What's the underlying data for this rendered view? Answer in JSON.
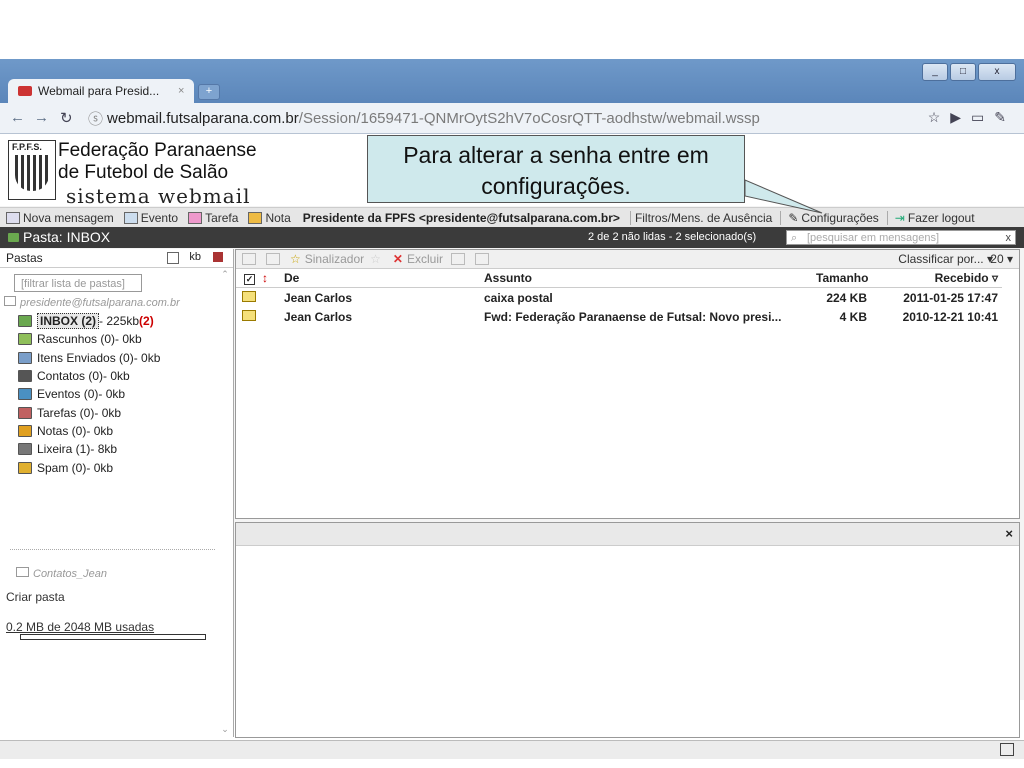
{
  "browser": {
    "tab_title": "Webmail para Presid...",
    "tab_close": "×",
    "new_tab": "+",
    "url_host": "webmail.futsalparana.com.br",
    "url_path": "/Session/1659471-QNMrOytS2hV7oCosrQTT-aodhstw/webmail.wssp",
    "window_buttons": [
      "_",
      "□",
      "x"
    ]
  },
  "header": {
    "logo_text": "F.P.F.S.",
    "brand_line1": "Federação Paranaense",
    "brand_line2": "de Futebol de Salão",
    "brand_line3": "sistema webmail"
  },
  "callout": {
    "line1": "Para alterar a senha entre em",
    "line2": "configurações."
  },
  "menubar": {
    "items": [
      "Nova mensagem",
      "Evento",
      "Tarefa",
      "Nota"
    ],
    "user": "Presidente da FPFS <presidente@futsalparana.com.br>",
    "filters": "Filtros/Mens. de Ausência",
    "settings": "Configurações",
    "logout": "Fazer logout"
  },
  "folderbar": {
    "title": "Pasta: INBOX",
    "status": "2 de 2 não lidas - 2 selecionado(s)",
    "search_placeholder": "[pesquisar em mensagens]",
    "search_close": "x"
  },
  "left": {
    "header": "Pastas",
    "kb": "kb",
    "filter_placeholder": "[filtrar lista de pastas]",
    "account": "presidente@futsalparana.com.br",
    "folders": [
      {
        "name": "INBOX (2)",
        "size": " - 225kb ",
        "unread": "(2)"
      },
      {
        "name": "Rascunhos (0)",
        "size": " - 0kb"
      },
      {
        "name": "Itens Enviados (0)",
        "size": " - 0kb"
      },
      {
        "name": "Contatos (0)",
        "size": " - 0kb"
      },
      {
        "name": "Eventos (0)",
        "size": " - 0kb"
      },
      {
        "name": "Tarefas (0)",
        "size": " - 0kb"
      },
      {
        "name": "Notas (0)",
        "size": " - 0kb"
      },
      {
        "name": "Lixeira (1)",
        "size": " - 8kb"
      },
      {
        "name": "Spam (0)",
        "size": " - 0kb"
      }
    ],
    "folder_colors": [
      "#6aa84f",
      "#8fbf5a",
      "#7a9ec9",
      "#555555",
      "#4a90c2",
      "#c06060",
      "#e0a020",
      "#777777",
      "#e0b030"
    ],
    "contacts": "Contatos_Jean",
    "create_folder": "Criar pasta",
    "quota": "0.2 MB de 2048 MB usadas",
    "quota_fraction": 0.0001
  },
  "messages": {
    "toolbar": {
      "flag": "Sinalizador",
      "delete": "Excluir",
      "sort": "Classificar por...",
      "count": "20"
    },
    "columns": {
      "check": "✓",
      "from": "De",
      "subject": "Assunto",
      "size": "Tamanho",
      "received": "Recebido"
    },
    "rows": [
      {
        "from": "Jean Carlos",
        "subject": "caixa postal",
        "size": "224 KB",
        "date": "2011-01-25 17:47"
      },
      {
        "from": "Jean Carlos",
        "subject": "Fwd: Federação Paranaense de Futsal: Novo presi...",
        "size": "4 KB",
        "date": "2010-12-21 10:41"
      }
    ]
  },
  "preview": {
    "close": "×"
  }
}
